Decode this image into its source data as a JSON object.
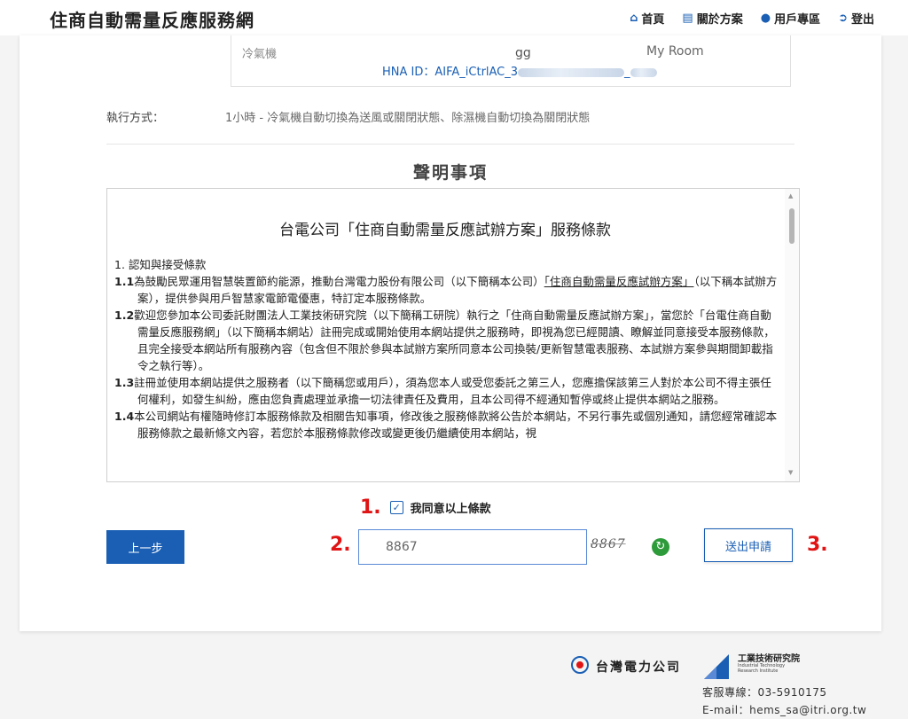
{
  "header": {
    "brand": "住商自動需量反應服務網",
    "nav": [
      {
        "icon": "home-icon",
        "label": "首頁"
      },
      {
        "icon": "list-icon",
        "label": "關於方案"
      },
      {
        "icon": "user-icon",
        "label": "用戶專區"
      },
      {
        "icon": "logout-icon",
        "label": "登出"
      }
    ]
  },
  "device": {
    "name": "冷氣機",
    "col2": "gg",
    "room": "My Room",
    "hna_label": "HNA ID：",
    "hna_value": "AIFA_iCtrlAC_3"
  },
  "exec": {
    "label": "執行方式：",
    "value": "1小時 - 冷氣機自動切換為送風或關閉狀態、除濕機自動切換為關閉狀態"
  },
  "section_title": "聲明事項",
  "terms": {
    "title": "台電公司「住商自動需量反應試辦方案」服務條款",
    "heading": "1. 認知與接受條款",
    "p11_a": "1.1",
    "p11_b": "為鼓勵民眾運用智慧裝置節約能源，推動台灣電力股份有限公司（以下簡稱本公司）",
    "p11_u": "「住商自動需量反應試辦方案」",
    "p11_c": "（以下稱本試辦方案），提供參與用戶智慧家電節電優惠，特訂定本服務條款。",
    "p12_a": "1.2",
    "p12_b": "歡迎您參加本公司委託財團法人工業技術研究院（以下簡稱工研院）執行之「住商自動需量反應試辦方案」，當您於「台電住商自動需量反應服務網」（以下簡稱本網站）註冊完成或開始使用本網站提供之服務時，即視為您已經閱讀、瞭解並同意接受本服務條款，且完全接受本網站所有服務內容（包含但不限於參與本試辦方案所同意本公司換裝/更新智慧電表服務、本試辦方案參與期間卸載指令之執行等）。",
    "p13_a": "1.3",
    "p13_b": "註冊並使用本網站提供之服務者（以下簡稱您或用戶），須為您本人或受您委託之第三人，您應擔保該第三人對於本公司不得主張任何權利，如發生糾紛，應由您負責處理並承擔一切法律責任及費用，且本公司得不經通知暫停或終止提供本網站之服務。",
    "p14_a": "1.4",
    "p14_b": "本公司網站有權隨時修訂本服務條款及相關告知事項，修改後之服務條款將公告於本網站，不另行事先或個別通知，請您經常確認本服務條款之最新條文內容，若您於本服務條款修改或變更後仍繼續使用本網站，視"
  },
  "agree": {
    "step": "1.",
    "label": "我同意以上條款",
    "checked": true
  },
  "actions": {
    "back_label": "上一步",
    "step2": "2.",
    "captcha_value": "8867",
    "captcha_image_text": "8867",
    "submit_label": "送出申請",
    "step3": "3."
  },
  "footer": {
    "taipower": "台灣電力公司",
    "itri_name": "工業技術研究院",
    "itri_en": "Industrial Technology Research Institute",
    "hotline": "客服專線：03-5910175",
    "email": "E-mail：hems_sa@itri.org.tw"
  }
}
